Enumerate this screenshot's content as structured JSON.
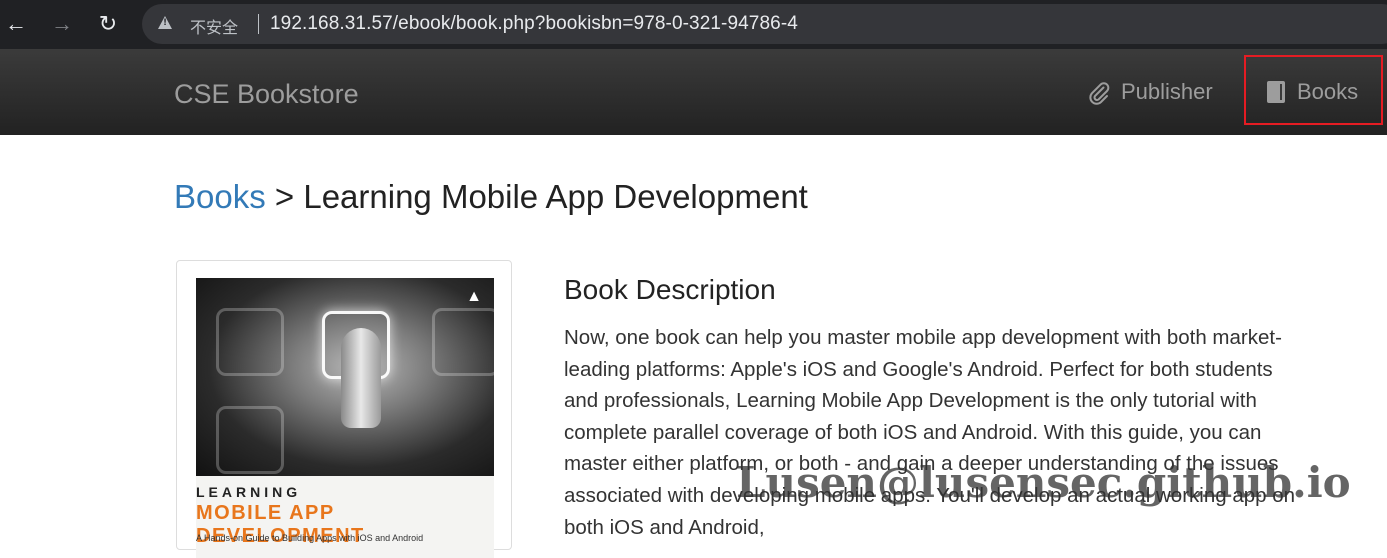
{
  "browser": {
    "back_icon": "arrow-left-icon",
    "forward_icon": "arrow-right-icon",
    "reload_icon": "reload-icon",
    "security_label": "不安全",
    "url": "192.168.31.57/ebook/book.php?bookisbn=978-0-321-94786-4"
  },
  "navbar": {
    "brand": "CSE Bookstore",
    "items": [
      {
        "label": "Publisher",
        "icon": "paperclip-icon"
      },
      {
        "label": "Books",
        "icon": "book-icon"
      }
    ],
    "highlight_color": "#e51c23"
  },
  "breadcrumb": {
    "parent": "Books",
    "separator": ">",
    "current": "Learning Mobile App Development"
  },
  "book": {
    "cover": {
      "learning": "LEARNING",
      "title": "MOBILE APP DEVELOPMENT",
      "subtitle": "A Hands-on Guide to Building Apps with iOS and Android"
    },
    "description_heading": "Book Description",
    "description": "Now, one book can help you master mobile app development with both market-leading platforms: Apple's iOS and Google's Android. Perfect for both students and professionals, Learning Mobile App Development is the only tutorial with complete parallel coverage of both iOS and Android. With this guide, you can master either platform, or both - and gain a deeper understanding of the issues associated with developing mobile apps. You'll develop an actual working app on both iOS and Android,"
  },
  "watermark": "Lusen@lusensec.github.io"
}
